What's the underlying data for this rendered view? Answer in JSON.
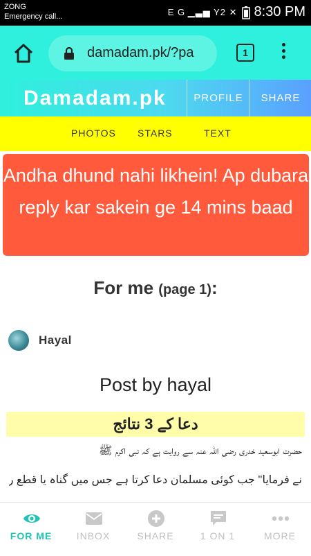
{
  "status_bar": {
    "carrier": "ZONG",
    "notification": "Emergency call...",
    "icons": "E G ▁▃▅ Y2 ✕",
    "time": "8:30 PM"
  },
  "browser": {
    "url": "damadam.pk/?pa",
    "tab_count": "1"
  },
  "site": {
    "logo": "Damadam.pk",
    "profile_link": "PROFILE",
    "share_link": "SHARE"
  },
  "subnav": {
    "items": [
      "PHOTOS",
      "STARS",
      "TEXT"
    ]
  },
  "alert": {
    "message": "Andha dhund nahi likhein! Ap dubara reply kar sakein ge 14 mins baad"
  },
  "page": {
    "heading": "For me",
    "page_label": "(page 1)",
    "colon": ":"
  },
  "post": {
    "username": "Hayal",
    "title": "Post by hayal"
  },
  "post_image": {
    "banner": "دعا کے 3 نتائج",
    "line1": "حضرت ابوسعید خدری رضی اللہ عنہ سے روایت ہے کہ نبی اکرم ﷺ",
    "line2": "نے فرمایا'' جب کوئی مسلمان دعا کرتا ہے جس میں گناہ یا قطع رحمی کی بات نہ ہو تو اللہ"
  },
  "bottom_nav": [
    {
      "label": "FOR ME",
      "icon": "eye-icon",
      "active": true
    },
    {
      "label": "INBOX",
      "icon": "mail-icon",
      "active": false
    },
    {
      "label": "SHARE",
      "icon": "plus-circle-icon",
      "active": false
    },
    {
      "label": "1 ON 1",
      "icon": "chat-icon",
      "active": false
    },
    {
      "label": "MORE",
      "icon": "more-dots-icon",
      "active": false
    }
  ],
  "colors": {
    "accent": "#2ef0dc",
    "alert": "#ff5a3c",
    "subnav": "#ffff00",
    "active_nav": "#1fc4b4"
  }
}
